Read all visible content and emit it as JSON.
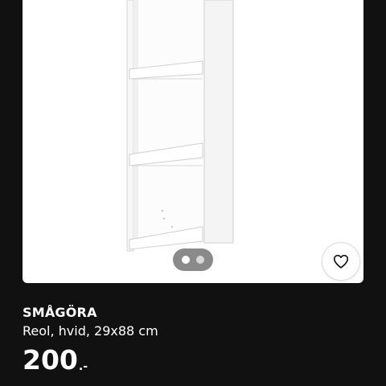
{
  "product": {
    "name": "SMÅGÖRA",
    "description": "Reol, hvid, 29x88 cm",
    "price_amount": "200",
    "price_suffix": ".-"
  },
  "carousel": {
    "total": 2,
    "active_index": 0
  },
  "icons": {
    "favorite": "heart-icon"
  },
  "colors": {
    "background": "#111111",
    "card": "#ffffff",
    "text": "#ffffff",
    "indicator": "#8a8a8a"
  }
}
